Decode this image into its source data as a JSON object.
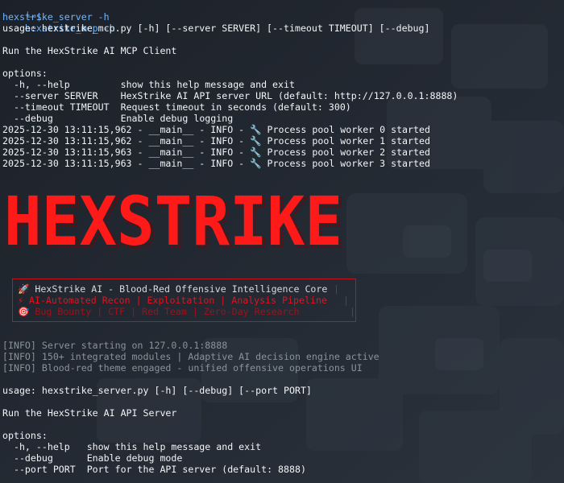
{
  "terminal": {
    "prompt_glyph": "└─$",
    "command_1": "hexstrike_mcp -h",
    "command_2": "hexstrike_server -h",
    "client_usage": "usage: hexstrike_mcp.py [-h] [--server SERVER] [--timeout TIMEOUT] [--debug]",
    "client_desc": "Run the HexStrike AI MCP Client",
    "options_label": "options:",
    "client_options": [
      {
        "flag": "  -h, --help         ",
        "desc": "show this help message and exit"
      },
      {
        "flag": "  --server SERVER    ",
        "desc": "HexStrike AI API server URL (default: http://127.0.0.1:8888)"
      },
      {
        "flag": "  --timeout TIMEOUT  ",
        "desc": "Request timeout in seconds (default: 300)"
      },
      {
        "flag": "  --debug            ",
        "desc": "Enable debug logging"
      }
    ],
    "log_lines": [
      "2025-12-30 13:11:15,962 - __main__ - INFO - 🔧 Process pool worker 0 started",
      "2025-12-30 13:11:15,962 - __main__ - INFO - 🔧 Process pool worker 1 started",
      "2025-12-30 13:11:15,963 - __main__ - INFO - 🔧 Process pool worker 2 started",
      "2025-12-30 13:11:15,963 - __main__ - INFO - 🔧 Process pool worker 3 started"
    ],
    "banner_text": "HEXSTRIKE",
    "box_lines": [
      "🚀 HexStrike AI - Blood-Red Offensive Intelligence Core",
      "⚡ AI-Automated Recon | Exploitation | Analysis Pipeline",
      "🎯 Bug Bounty | CTF | Red Team | Zero-Day Research"
    ],
    "info_lines": [
      "[INFO] Server starting on 127.0.0.1:8888",
      "[INFO] 150+ integrated modules | Adaptive AI decision engine active",
      "[INFO] Blood-red theme engaged - unified offensive operations UI"
    ],
    "server_usage": "usage: hexstrike_server.py [-h] [--debug] [--port PORT]",
    "server_desc": "Run the HexStrike AI API Server",
    "server_options": [
      {
        "flag": "  -h, --help   ",
        "desc": "show this help message and exit"
      },
      {
        "flag": "  --debug      ",
        "desc": "Enable debug mode"
      },
      {
        "flag": "  --port PORT  ",
        "desc": "Port for the API server (default: 8888)"
      }
    ],
    "colors": {
      "accent_red": "#ff2a2a",
      "prompt_blue": "#6fb6ff",
      "background": "#20262f"
    }
  }
}
